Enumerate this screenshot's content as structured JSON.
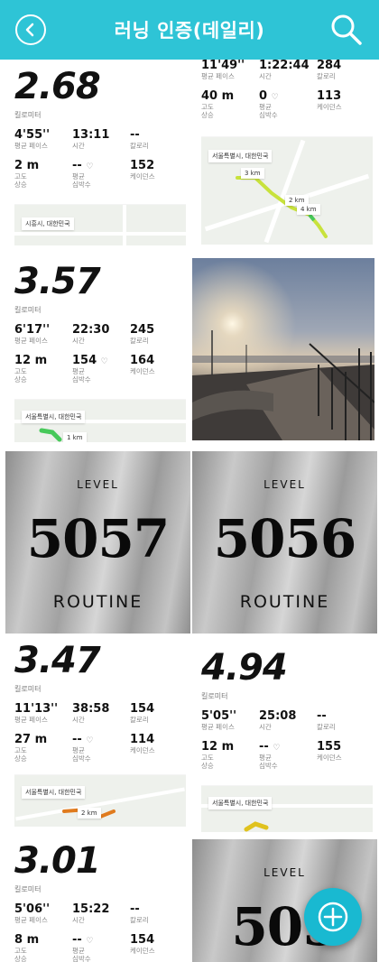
{
  "header": {
    "title": "러닝 인증(데일리)"
  },
  "labels": {
    "km": "킬로미터",
    "pace": "평균 페이스",
    "time": "시간",
    "cal": "칼로리",
    "elev": "고도 상승",
    "elev_a": "고도",
    "elev_b": "상승",
    "hr_a": "평균",
    "hr_b": "심박수",
    "cadence": "케이던스",
    "level": "LEVEL",
    "routine": "ROUTINE"
  },
  "cards": [
    {
      "km": "2.68",
      "pace": "4'55''",
      "time": "13:11",
      "cal": "--",
      "elev": "2 m",
      "hr": "--",
      "cad": "152",
      "map_label": "시흥시, 대한민국"
    },
    {
      "km": "",
      "pace": "11'49''",
      "time": "1:22:44",
      "cal": "284",
      "elev": "40 m",
      "hr": "0",
      "cad": "113",
      "map_label": "서울특별시, 대한민국",
      "map_marks": [
        "3 km",
        "2 km",
        "4 km"
      ]
    },
    {
      "km": "3.57",
      "pace": "6'17''",
      "time": "22:30",
      "cal": "245",
      "elev": "12 m",
      "hr": "154",
      "cad": "164",
      "map_label": "서울특별시, 대한민국",
      "map_marks": [
        "1 km"
      ]
    },
    {
      "km": "3.47",
      "pace": "11'13''",
      "time": "38:58",
      "cal": "154",
      "elev": "27 m",
      "hr": "--",
      "cad": "114",
      "map_label": "서울특별시, 대한민국",
      "map_marks": [
        "2 km"
      ]
    },
    {
      "km": "4.94",
      "pace": "5'05''",
      "time": "25:08",
      "cal": "--",
      "elev": "12 m",
      "hr": "--",
      "cad": "155",
      "map_label": "서울특별시, 대한민국"
    },
    {
      "km": "3.01",
      "pace": "5'06''",
      "time": "15:22",
      "cal": "--",
      "elev": "8 m",
      "hr": "--",
      "cad": "154"
    }
  ],
  "levels": [
    {
      "number": "5057"
    },
    {
      "number": "5056"
    },
    {
      "number": "505"
    }
  ]
}
